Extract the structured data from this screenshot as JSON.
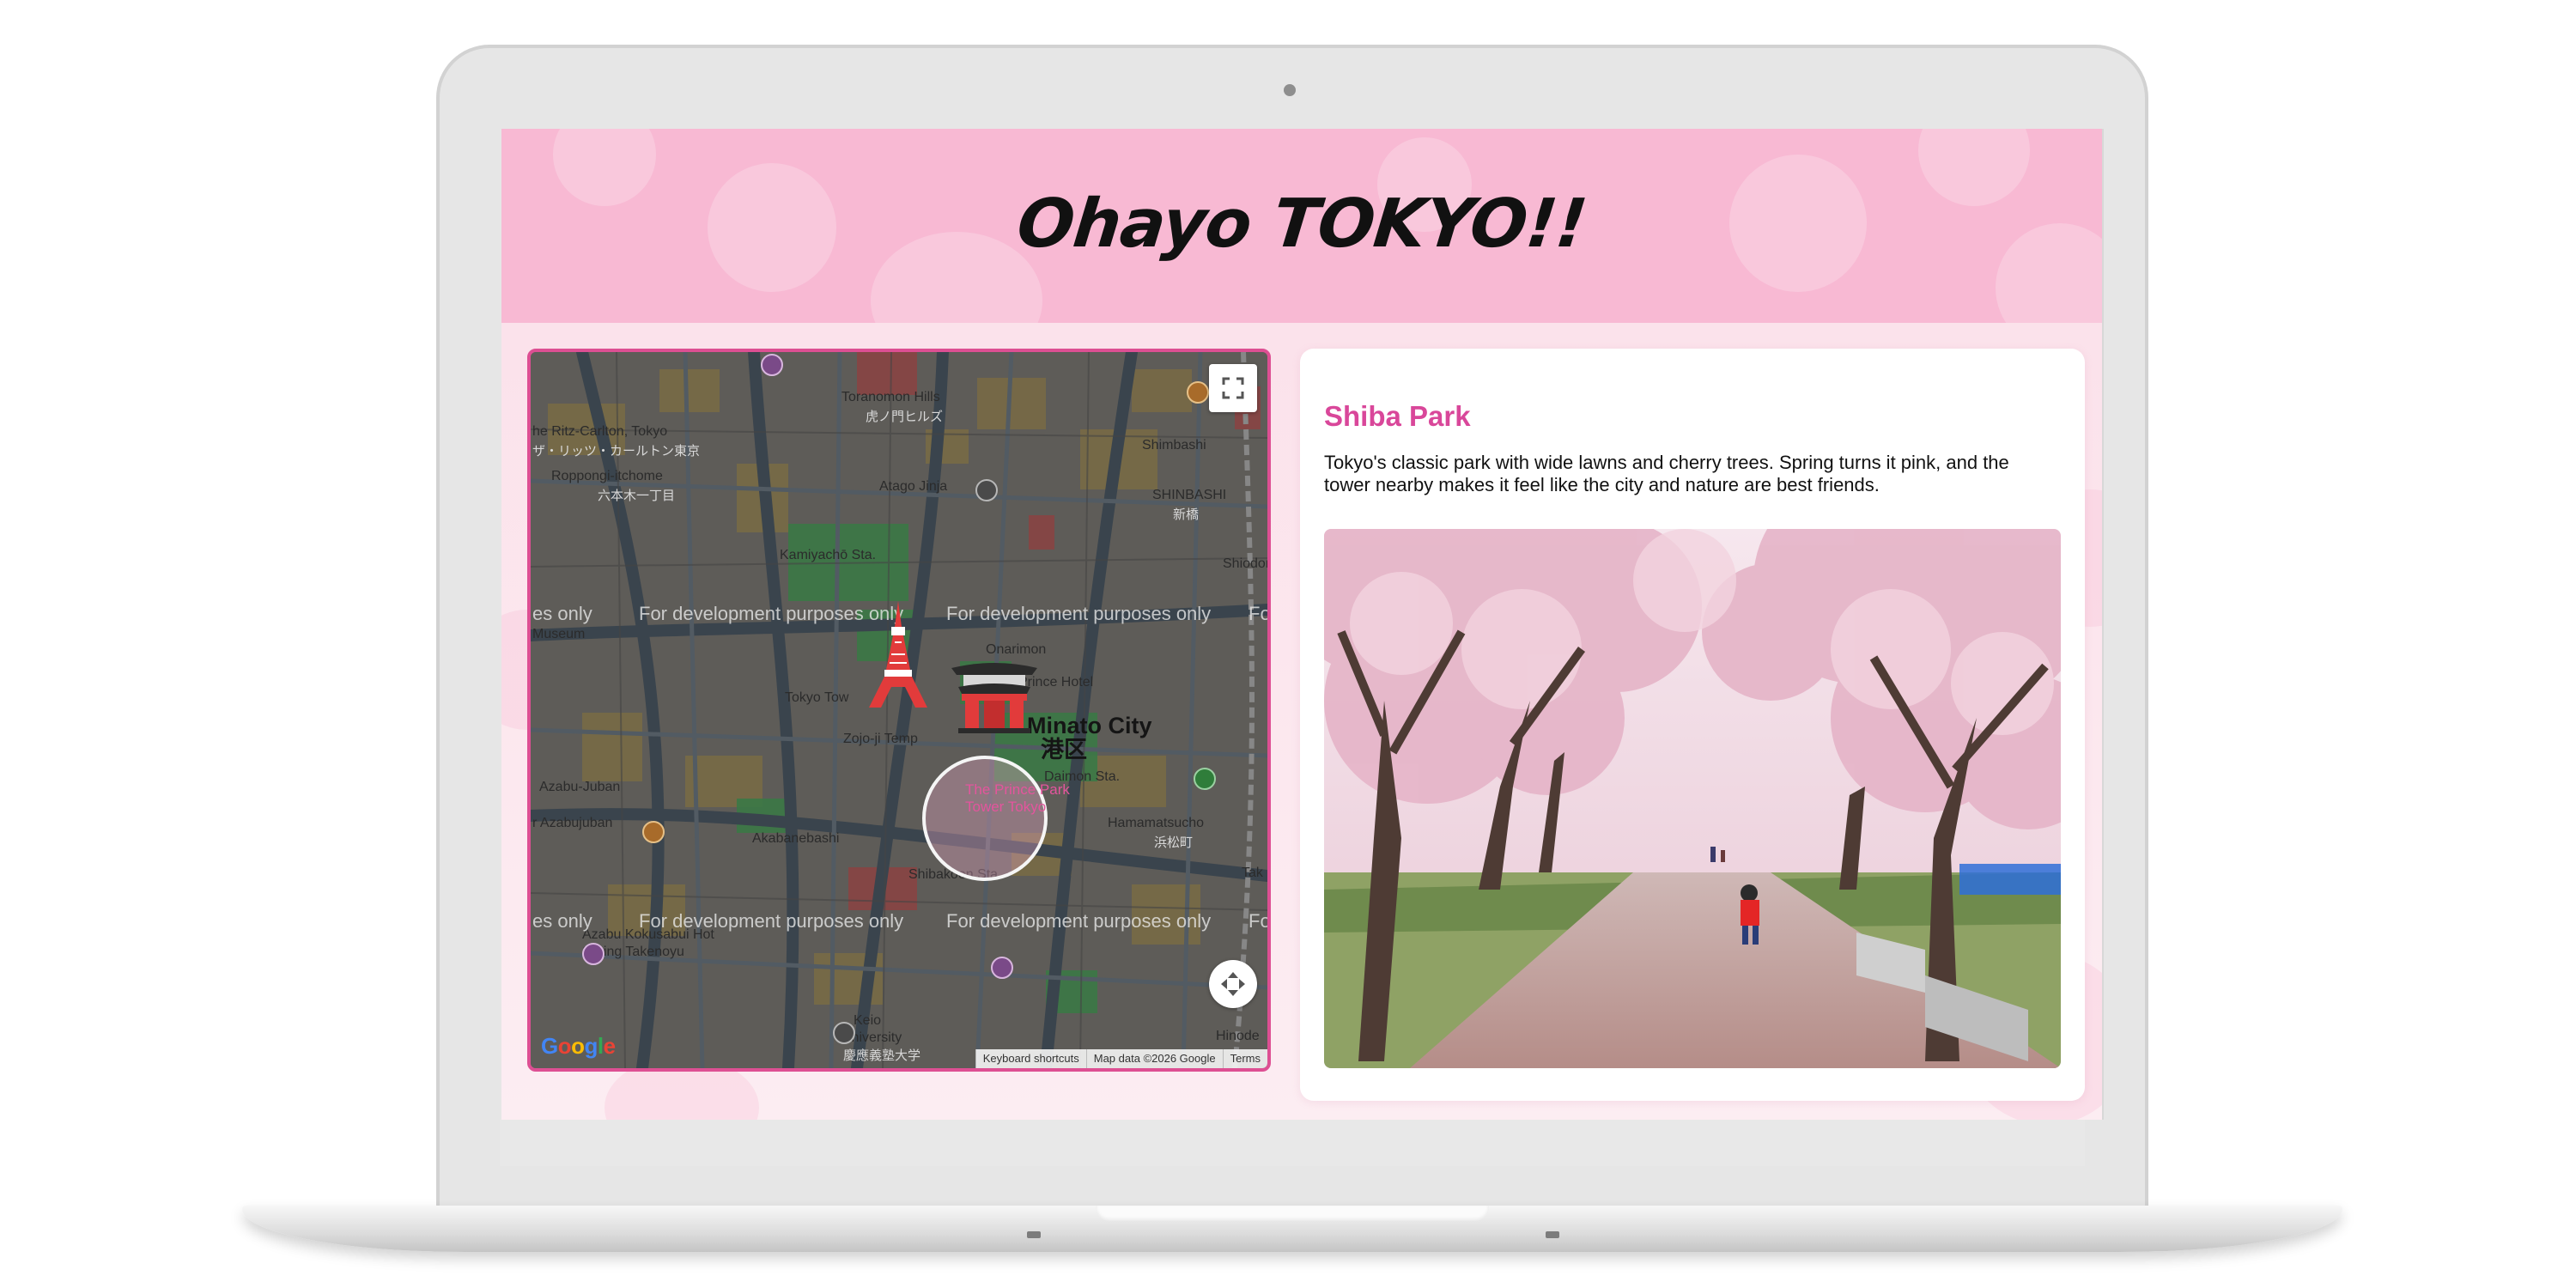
{
  "site": {
    "title": "Ohayo TOKYO!!"
  },
  "map": {
    "watermark": "For development purposes only",
    "city_label_en": "Minato City",
    "city_label_jp": "港区",
    "labels": {
      "ritz": "he Ritz-Carlton, Tokyo",
      "ritz_jp": "ザ・リッツ・カールトン東京",
      "roppongi": "Roppongi-itchome",
      "roppongi_jp": "六本木一丁目",
      "toranomon": "Toranomon Hills",
      "toranomon_jp": "虎ノ門ヒルズ",
      "atago": "Atago Jinja",
      "kamiyacho": "Kamiyachō Sta.",
      "shimbashi": "Shimbashi",
      "shimbashi_big": "SHINBASHI",
      "shimbashi_jp": "新橋",
      "shiodome": "Shiodom",
      "museum": "Museum",
      "onarimon": "Onarimon",
      "prince": "Prince Hotel",
      "tokyotower": "Tokyo Tow",
      "zojoji": "Zojo-ji Temp",
      "daimon": "Daimon Sta.",
      "hamamatsucho": "Hamamatsucho",
      "hamamatsucho_jp": "浜松町",
      "azabujuban": "Azabu-Juban",
      "azabujuban2": "r Azabujuban",
      "akabanebashi": "Akabanebashi",
      "shibakoen": "Shibakoen Sta.",
      "kokusai": "Azabu Kokusabui Hot",
      "kokusai2": "Spring Takenoyu",
      "keio": "Keio",
      "keio2": "University",
      "keio_jp": "慶應義塾大学",
      "hinode": "Hinode",
      "take": "Tak",
      "prince_park": "The Prince Park",
      "prince_park2": "Tower Tokyo",
      "fo": "Fo",
      "es": "es only"
    },
    "attribution": {
      "shortcuts": "Keyboard shortcuts",
      "data": "Map data ©2026 Google",
      "terms": "Terms"
    },
    "logo_text": "Google",
    "fullscreen_icon": "fullscreen-icon",
    "camera_icon": "camera-control-icon",
    "markers": [
      "tokyo-tower-icon",
      "temple-gate-icon"
    ]
  },
  "place": {
    "title": "Shiba Park",
    "description": "Tokyo's classic park with wide lawns and cherry trees. Spring turns it pink, and the tower nearby makes it feel like the city and nature are best friends.",
    "photo_icon": "cherry-blossom-photo"
  },
  "colors": {
    "header": "#f8b9d3",
    "accent": "#d9479a",
    "map_border": "#dd4f93"
  }
}
